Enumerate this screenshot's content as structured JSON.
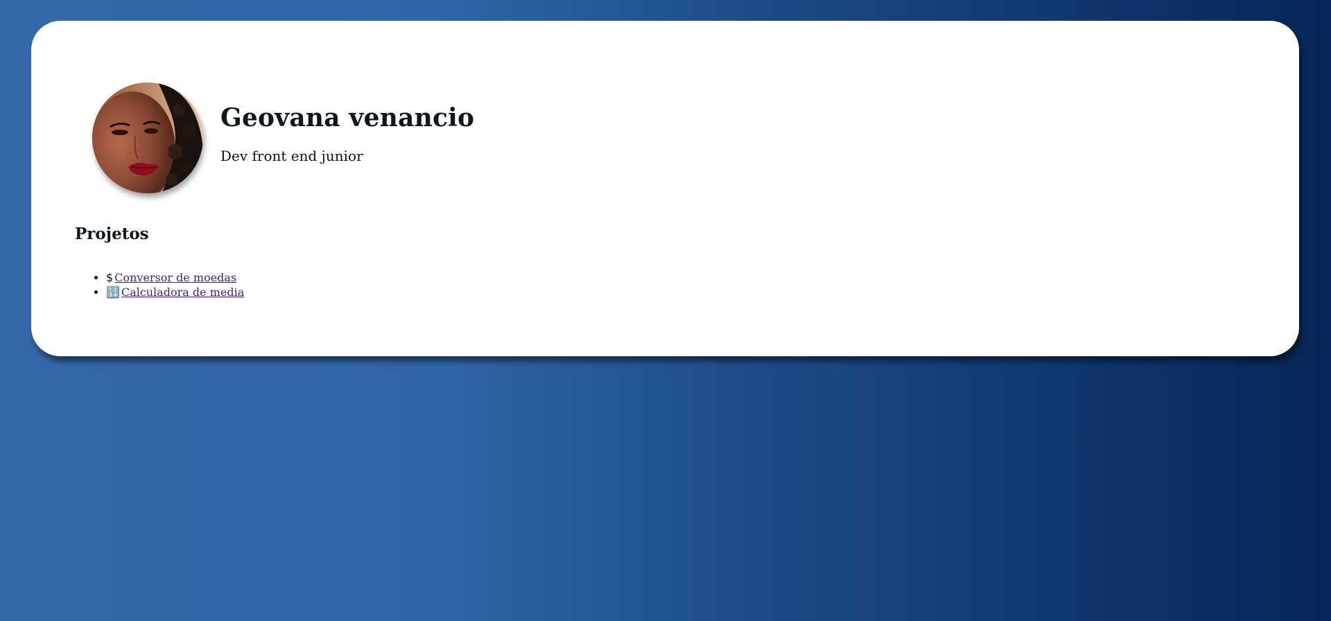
{
  "profile": {
    "name": "Geovana venancio",
    "role": "Dev front end junior"
  },
  "projects": {
    "title": "Projetos",
    "items": [
      {
        "icon": "$",
        "icon_name": "dollar-icon",
        "label": "Conversor de moedas"
      },
      {
        "icon": "🔢",
        "icon_name": "numbers-icon",
        "label": "Calculadora de media"
      }
    ]
  },
  "colors": {
    "background_gradient": [
      "#3468a9",
      "#3165a7",
      "#1d4a86",
      "#0f3770",
      "#062656"
    ],
    "card": "#ffffff",
    "heading": "#0d1720",
    "link": "#4a1a7a"
  }
}
